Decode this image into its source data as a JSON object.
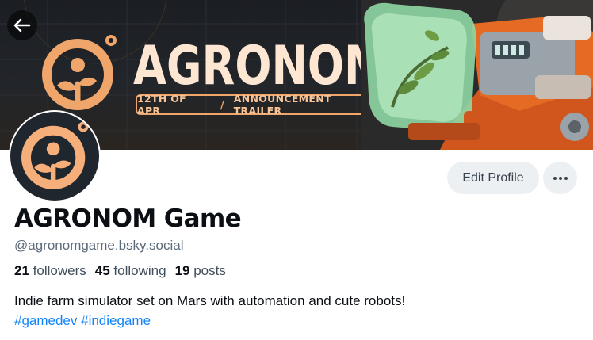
{
  "banner": {
    "title": "AGRONOM",
    "subtitle_date": "12TH OF APR",
    "subtitle_separator": "/",
    "subtitle_text": "ANNOUNCEMENT TRAILER",
    "colors": {
      "accent": "#f0a56a",
      "dark": "#1b1e23"
    }
  },
  "navigation": {
    "back_icon": "arrow-left-icon"
  },
  "profile": {
    "display_name": "AGRONOM Game",
    "handle": "@agronomgame.bsky.social",
    "edit_button_label": "Edit Profile",
    "more_icon": "ellipsis-icon",
    "stats": {
      "followers_count": "21",
      "followers_label": "followers",
      "following_count": "45",
      "following_label": "following",
      "posts_count": "19",
      "posts_label": "posts"
    },
    "bio": "Indie farm simulator set on Mars with automation and cute robots!",
    "tags": [
      "#gamedev",
      "#indiegame"
    ],
    "link_color": "#1083fe"
  }
}
